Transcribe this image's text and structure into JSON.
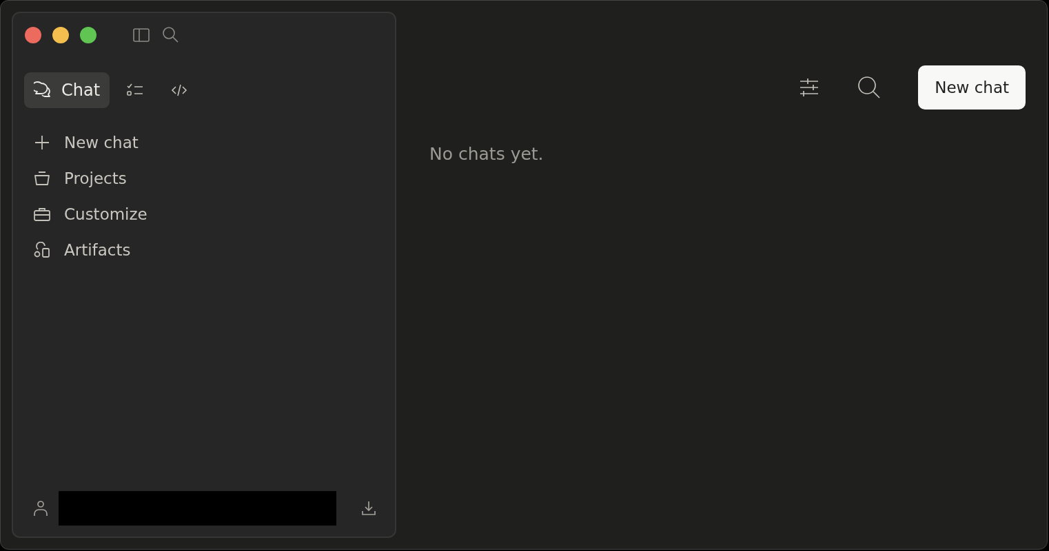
{
  "tabs": [
    {
      "kind": "chat",
      "label": "Chat",
      "selected": true
    },
    {
      "kind": "tasks",
      "selected": false
    },
    {
      "kind": "code",
      "selected": false
    }
  ],
  "nav": [
    {
      "kind": "new",
      "label": "New chat"
    },
    {
      "kind": "projects",
      "label": "Projects"
    },
    {
      "kind": "customize",
      "label": "Customize"
    },
    {
      "kind": "artifacts",
      "label": "Artifacts"
    }
  ],
  "account": {
    "name_redacted": true
  },
  "main": {
    "empty_message": "No chats yet.",
    "new_chat_button": "New chat"
  }
}
